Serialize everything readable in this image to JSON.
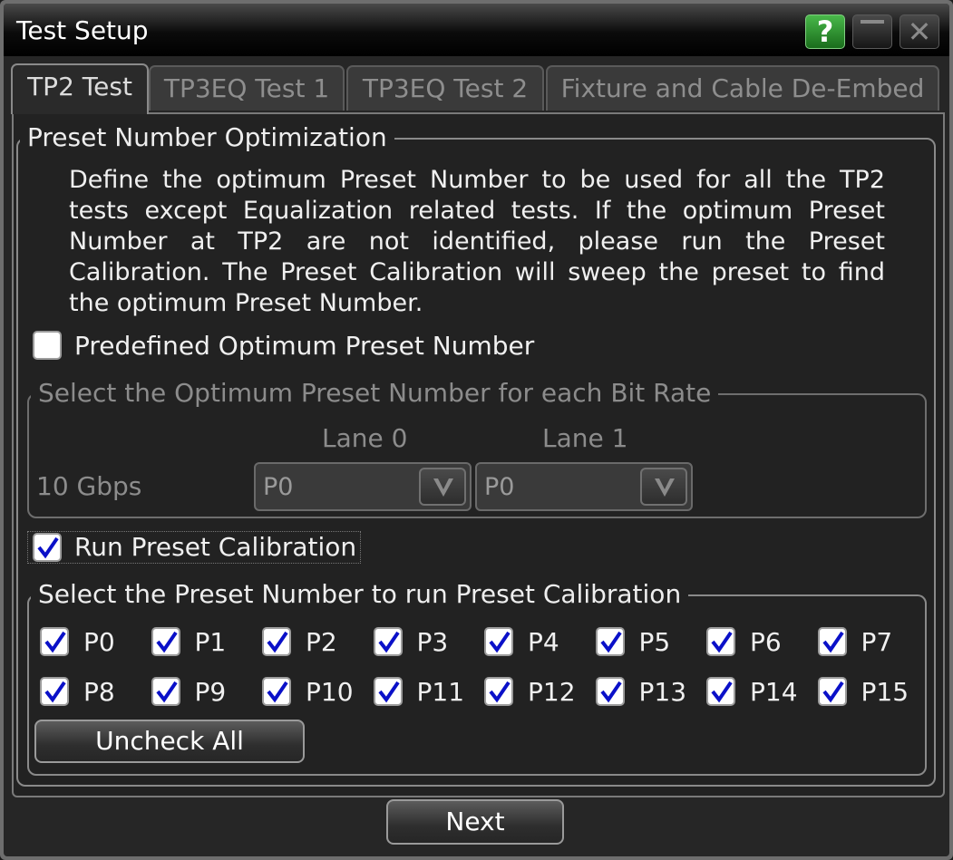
{
  "window": {
    "title": "Test Setup"
  },
  "tabs": [
    "TP2 Test",
    "TP3EQ Test 1",
    "TP3EQ Test 2",
    "Fixture and Cable De-Embed"
  ],
  "preset_group": {
    "legend": "Preset Number Optimization",
    "description": "Define the optimum Preset Number to be used for all the TP2 tests except Equalization related tests. If the optimum Preset Number at TP2 are not identified, please run the Preset Calibration. The Preset Calibration will sweep the preset to find the optimum Preset Number."
  },
  "predefined": {
    "label": "Predefined Optimum Preset Number",
    "checked": false
  },
  "optimum_group": {
    "legend": "Select the Optimum Preset Number for each Bit Rate",
    "lane0": "Lane 0",
    "lane1": "Lane 1",
    "bitrate": "10 Gbps",
    "lane0_value": "P0",
    "lane1_value": "P0"
  },
  "run_calibration": {
    "label": "Run Preset Calibration",
    "checked": true
  },
  "calibration_group": {
    "legend": "Select the Preset Number to run Preset Calibration",
    "presets": [
      "P0",
      "P1",
      "P2",
      "P3",
      "P4",
      "P5",
      "P6",
      "P7",
      "P8",
      "P9",
      "P10",
      "P11",
      "P12",
      "P13",
      "P14",
      "P15"
    ],
    "uncheck_all": "Uncheck All"
  },
  "footer": {
    "next": "Next"
  },
  "colors": {
    "check": "#0a10c8",
    "help_button": "#2f8f31"
  }
}
